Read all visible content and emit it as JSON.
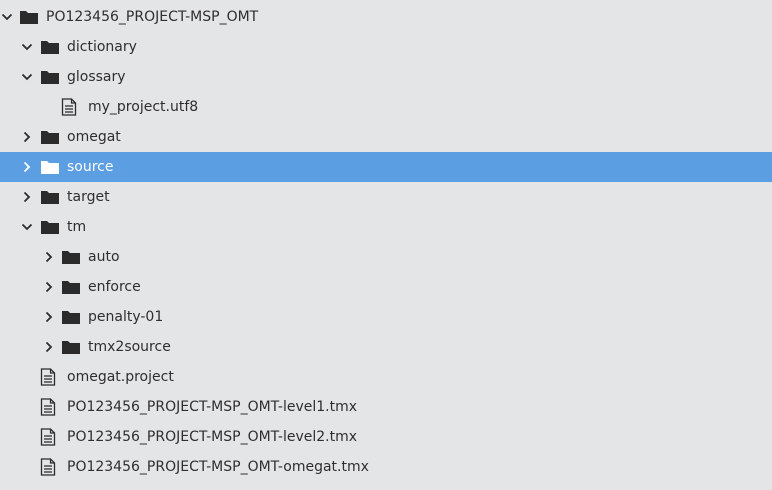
{
  "tree": {
    "root": {
      "label": "PO123456_PROJECT-MSP_OMT",
      "expanded": true,
      "icon": "folder-icon"
    },
    "items": [
      {
        "label": "dictionary",
        "type": "folder",
        "expanded": true
      },
      {
        "label": "glossary",
        "type": "folder",
        "expanded": true
      },
      {
        "label": "my_project.utf8",
        "type": "file"
      },
      {
        "label": "omegat",
        "type": "folder",
        "expanded": false
      },
      {
        "label": "source",
        "type": "folder",
        "expanded": false,
        "selected": true
      },
      {
        "label": "target",
        "type": "folder",
        "expanded": false
      },
      {
        "label": "tm",
        "type": "folder",
        "expanded": true
      },
      {
        "label": "auto",
        "type": "folder",
        "expanded": false
      },
      {
        "label": "enforce",
        "type": "folder",
        "expanded": false
      },
      {
        "label": "penalty-01",
        "type": "folder",
        "expanded": false
      },
      {
        "label": "tmx2source",
        "type": "folder",
        "expanded": false
      },
      {
        "label": "omegat.project",
        "type": "file"
      },
      {
        "label": "PO123456_PROJECT-MSP_OMT-level1.tmx",
        "type": "file"
      },
      {
        "label": "PO123456_PROJECT-MSP_OMT-level2.tmx",
        "type": "file"
      },
      {
        "label": "PO123456_PROJECT-MSP_OMT-omegat.tmx",
        "type": "file"
      }
    ]
  },
  "colors": {
    "background": "#e4e5e7",
    "selection": "#5b9fe2",
    "icon": "#2b2b2b",
    "text": "#2e2e2e"
  }
}
